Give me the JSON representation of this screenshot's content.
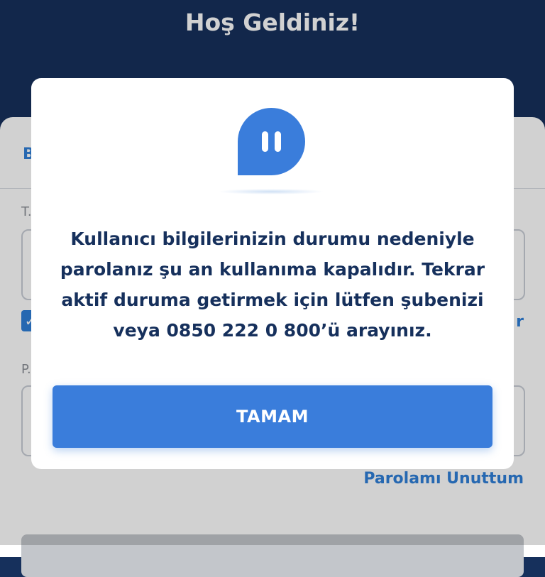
{
  "header": {
    "title": "Hoş Geldiniz!"
  },
  "login_form": {
    "tab_label": "B",
    "tc_label": "T.",
    "tc_value": "",
    "remember_checked": true,
    "right_link_partial": "r",
    "password_label": "P.",
    "password_value": "",
    "forgot_password_link": "Parolamı Unuttum"
  },
  "dialog": {
    "icon": "pause-chat-icon",
    "message": "Kullanıcı bilgilerinizin durumu nedeniyle parolanız şu an kullanıma kapalıdır. Tekrar aktif duruma getirmek için lütfen şubenizi veya 0850 222 0 800’ü arayınız.",
    "ok_button": "TAMAM"
  },
  "colors": {
    "brand_navy": "#16305c",
    "primary_blue": "#3a7ddb",
    "link_blue": "#2f7fd8"
  }
}
